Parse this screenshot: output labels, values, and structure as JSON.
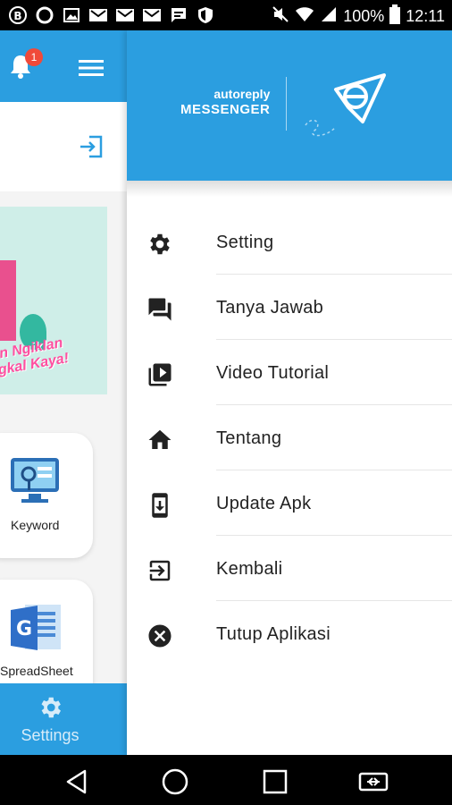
{
  "status_bar": {
    "battery": "100%",
    "time": "12:11"
  },
  "app": {
    "notification_count": "1",
    "banner_slogan_line1": "in Ngiklan",
    "banner_slogan_line2": "gkal Kaya!",
    "cards": [
      {
        "label": "Keyword"
      },
      {
        "label": "SpreadSheet"
      }
    ],
    "footer_label": "Settings"
  },
  "drawer": {
    "brand_small": "autoreply",
    "brand_big": "MESSENGER",
    "items": [
      {
        "label": "Setting",
        "icon": "gear-icon"
      },
      {
        "label": "Tanya Jawab",
        "icon": "chat-icon"
      },
      {
        "label": "Video Tutorial",
        "icon": "video-library-icon"
      },
      {
        "label": "Tentang",
        "icon": "home-icon"
      },
      {
        "label": "Update Apk",
        "icon": "phone-download-icon"
      },
      {
        "label": "Kembali",
        "icon": "exit-icon"
      },
      {
        "label": "Tutup Aplikasi",
        "icon": "close-circle-icon"
      }
    ]
  },
  "colors": {
    "primary": "#2b9ee0",
    "badge": "#f04a3a"
  }
}
